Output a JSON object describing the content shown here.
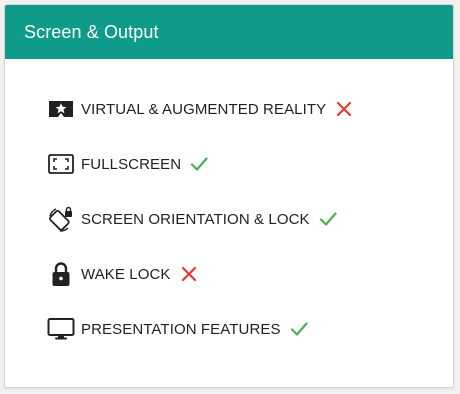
{
  "card": {
    "title": "Screen & Output",
    "header_color": "#0f9b89"
  },
  "features": [
    {
      "label": "VIRTUAL & AUGMENTED REALITY",
      "icon": "vr-star-icon",
      "supported": false
    },
    {
      "label": "FULLSCREEN",
      "icon": "fullscreen-icon",
      "supported": true
    },
    {
      "label": "SCREEN ORIENTATION & LOCK",
      "icon": "screen-rotation-lock-icon",
      "supported": true
    },
    {
      "label": "WAKE LOCK",
      "icon": "padlock-icon",
      "supported": false
    },
    {
      "label": "PRESENTATION FEATURES",
      "icon": "monitor-icon",
      "supported": true
    }
  ],
  "status_colors": {
    "supported": "#4caf50",
    "unsupported": "#e53935"
  }
}
